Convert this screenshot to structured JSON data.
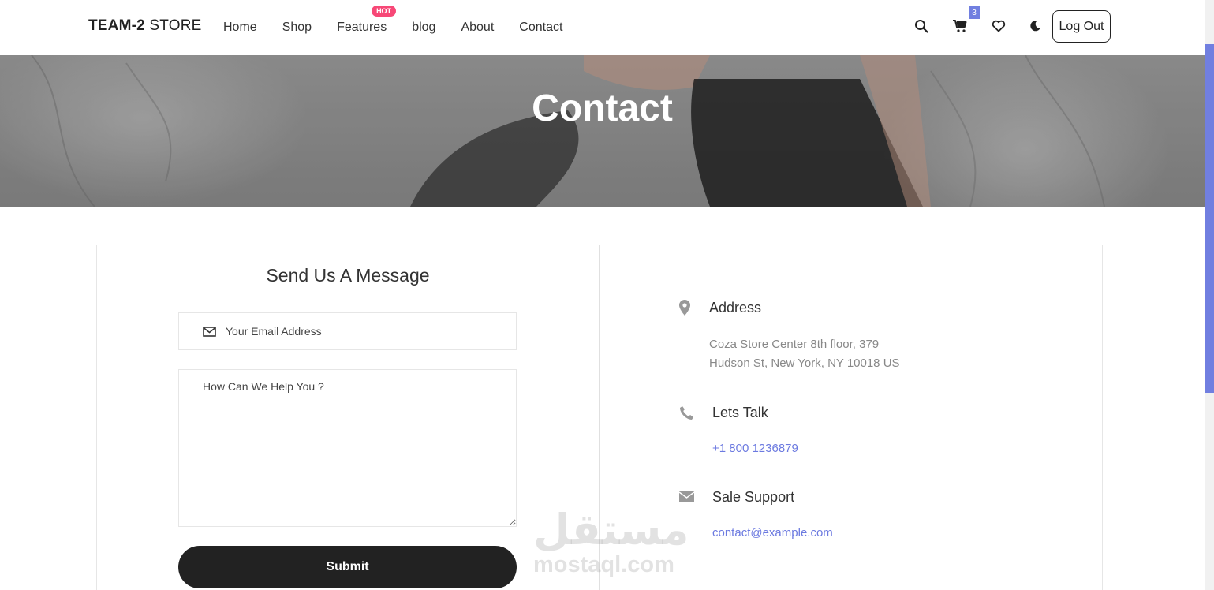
{
  "header": {
    "logo_bold": "TEAM-2",
    "logo_rest": " STORE",
    "nav": [
      {
        "label": "Home"
      },
      {
        "label": "Shop"
      },
      {
        "label": "Features",
        "badge": "HOT"
      },
      {
        "label": "blog"
      },
      {
        "label": "About"
      },
      {
        "label": "Contact"
      }
    ],
    "cart_count": "3",
    "logout_label": "Log Out",
    "icons": [
      "search-icon",
      "cart-icon",
      "heart-icon",
      "moon-icon"
    ]
  },
  "hero": {
    "title": "Contact"
  },
  "form": {
    "title": "Send Us A Message",
    "email_placeholder": "Your Email Address",
    "message_placeholder": "How Can We Help You ?",
    "submit_label": "Submit"
  },
  "info": {
    "address": {
      "icon": "map-pin-icon",
      "title": "Address",
      "line1": "Coza Store Center 8th floor, 379",
      "line2": "Hudson St, New York, NY 10018 US"
    },
    "talk": {
      "icon": "phone-icon",
      "title": "Lets Talk",
      "value": "+1 800 1236879"
    },
    "support": {
      "icon": "envelope-icon",
      "title": "Sale Support",
      "value": "contact@example.com"
    }
  },
  "watermark": {
    "arabic": "مستقل",
    "latin": "mostaql.com"
  },
  "colors": {
    "accent": "#717fe0",
    "hot_badge": "#f74877",
    "button": "#222222"
  }
}
